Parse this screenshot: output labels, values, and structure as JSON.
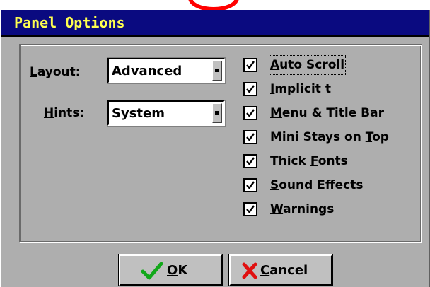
{
  "window": {
    "title": "Panel Options"
  },
  "layout": {
    "label_prefix": "",
    "label_hotkey": "L",
    "label_rest": "ayout:",
    "value": "Advanced"
  },
  "hints": {
    "label_hotkey": "H",
    "label_rest": "ints:",
    "value": "System"
  },
  "options": [
    {
      "pre": "",
      "hotkey": "A",
      "post": "uto Scroll",
      "checked": true,
      "focused": true
    },
    {
      "pre": "",
      "hotkey": "I",
      "post": "mplicit t",
      "checked": true
    },
    {
      "pre": "",
      "hotkey": "M",
      "post": "enu & Title Bar",
      "checked": true
    },
    {
      "pre": "Mini Stays on ",
      "hotkey": "T",
      "post": "op",
      "checked": true
    },
    {
      "pre": "Thick ",
      "hotkey": "F",
      "post": "onts",
      "checked": true
    },
    {
      "pre": "",
      "hotkey": "S",
      "post": "ound Effects",
      "checked": true
    },
    {
      "pre": "",
      "hotkey": "W",
      "post": "arnings",
      "checked": true
    }
  ],
  "buttons": {
    "ok": {
      "hotkey": "O",
      "rest": "K"
    },
    "cancel": {
      "hotkey": "C",
      "rest": "ancel"
    }
  },
  "colors": {
    "titlebar": "#0a0a80",
    "title_text": "#ffff4f",
    "dialog_face": "#aeaeae",
    "ok_check": "#12a81a",
    "cancel_x": "#e01010"
  },
  "icons": {
    "ok": "checkmark-icon",
    "cancel": "x-icon",
    "dropdown": "dropdown-arrow-icon",
    "checkbox": "checkbox-check-icon"
  }
}
